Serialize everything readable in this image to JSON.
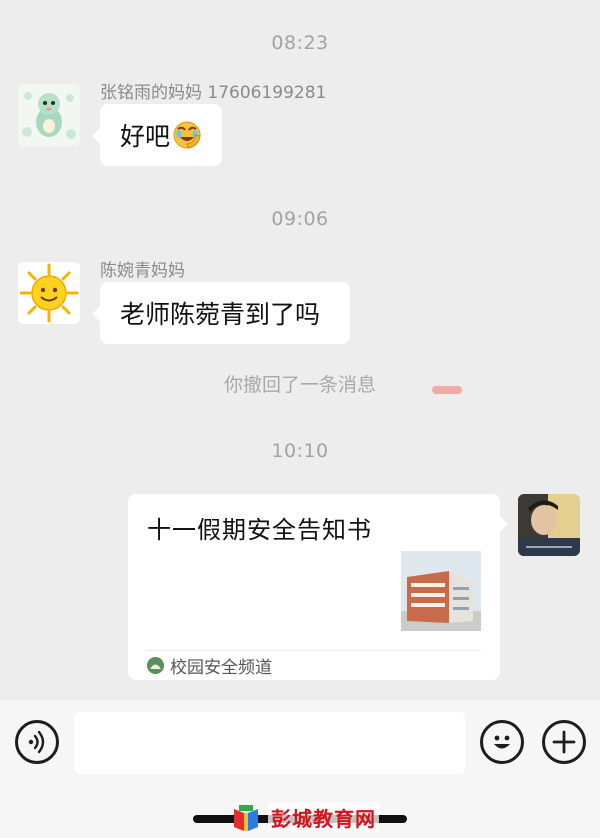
{
  "messages": {
    "time1": "08:23",
    "msg1": {
      "sender": "张铭雨的妈妈 17606199281",
      "text": "好吧",
      "emoji_icon": "facepalm-laugh-emoji"
    },
    "time2": "09:06",
    "msg2": {
      "sender": "陈婉青妈妈",
      "text": "老师陈菀青到了吗"
    },
    "recall_notice": "你撤回了一条消息",
    "time3": "10:10",
    "card": {
      "title": "十一假期安全告知书",
      "source": "校园安全频道"
    }
  },
  "input_bar": {
    "voice_icon": "voice-icon",
    "emoji_icon": "emoji-icon",
    "plus_icon": "plus-icon",
    "text_value": ""
  },
  "watermark": {
    "text": "彭城教育网"
  },
  "colors": {
    "background": "#ededed",
    "bubble": "#ffffff",
    "timestamp": "#a3a3a3",
    "watermark_red": "#d8131b"
  }
}
